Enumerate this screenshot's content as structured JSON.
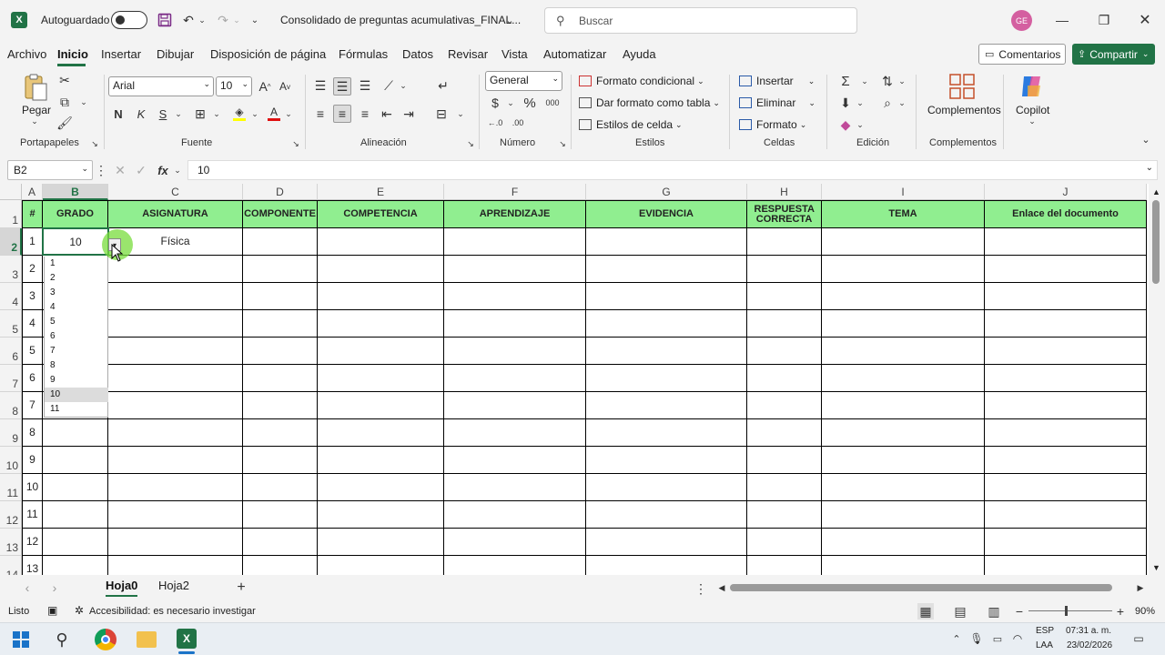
{
  "titlebar": {
    "autosave_label": "Autoguardado",
    "autosave_state": "off",
    "doc_title": "Consolidado de preguntas acumulativas_FINAL...",
    "search_placeholder": "Buscar",
    "avatar_initials": "GE",
    "accent_color": "#217346"
  },
  "menu": {
    "items": [
      "Archivo",
      "Inicio",
      "Insertar",
      "Dibujar",
      "Disposición de página",
      "Fórmulas",
      "Datos",
      "Revisar",
      "Vista",
      "Automatizar",
      "Ayuda"
    ],
    "active": "Inicio",
    "comments_label": "Comentarios",
    "share_label": "Compartir"
  },
  "ribbon": {
    "clipboard": {
      "paste_label": "Pegar",
      "group_label": "Portapapeles"
    },
    "font": {
      "family": "Arial",
      "size": "10",
      "bold": "N",
      "italic": "K",
      "underline": "S",
      "group_label": "Fuente"
    },
    "alignment": {
      "group_label": "Alineación"
    },
    "number": {
      "format": "General",
      "group_label": "Número"
    },
    "styles": {
      "conditional": "Formato condicional",
      "as_table": "Dar formato como tabla",
      "cell_styles": "Estilos de celda",
      "group_label": "Estilos"
    },
    "cells": {
      "insert": "Insertar",
      "delete": "Eliminar",
      "format": "Formato",
      "group_label": "Celdas"
    },
    "editing": {
      "group_label": "Edición"
    },
    "addins": {
      "label": "Complementos",
      "group_label": "Complementos"
    },
    "copilot": {
      "label": "Copilot"
    }
  },
  "formula_bar": {
    "name_box": "B2",
    "fx": "fx",
    "value": "10"
  },
  "sheet": {
    "columns": [
      "A",
      "B",
      "C",
      "D",
      "E",
      "F",
      "G",
      "H",
      "I",
      "J"
    ],
    "headers": [
      "#",
      "GRADO",
      "ASIGNATURA",
      "COMPONENTE",
      "COMPETENCIA",
      "APRENDIZAJE",
      "EVIDENCIA",
      "RESPUESTA CORRECTA",
      "TEMA",
      "Enlace del documento"
    ],
    "header_fill": "#90ee90",
    "row_numbers": [
      "1",
      "2",
      "3",
      "4",
      "5",
      "6",
      "7",
      "8",
      "9",
      "10",
      "11",
      "12",
      "13",
      "14"
    ],
    "index_values": [
      "1",
      "2",
      "3",
      "4",
      "5",
      "6",
      "7",
      "8",
      "9",
      "10",
      "11",
      "12",
      "13"
    ],
    "b2": "10",
    "c2": "Física",
    "dropdown_options": [
      "1",
      "2",
      "3",
      "4",
      "5",
      "6",
      "7",
      "8",
      "9",
      "10",
      "11"
    ],
    "dropdown_selected": "10"
  },
  "tabs": {
    "sheets": [
      "Hoja0",
      "Hoja2"
    ],
    "active": "Hoja0"
  },
  "status": {
    "ready": "Listo",
    "accessibility": "Accesibilidad: es necesario investigar",
    "zoom": "90%"
  },
  "taskbar": {
    "lang_top": "ESP",
    "lang_bottom": "LAA",
    "time": "07:31 a. m.",
    "date": "23/02/2026"
  }
}
